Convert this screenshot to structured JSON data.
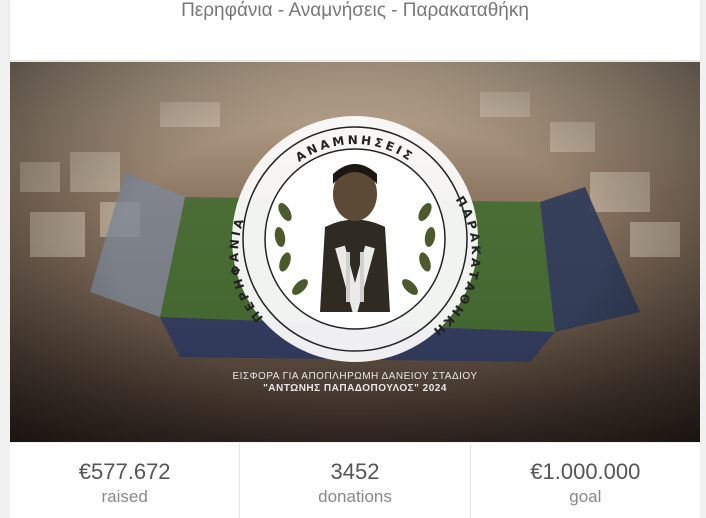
{
  "header": {
    "title": "Περηφάνια - Αναμνήσεις - Παρακαταθήκη"
  },
  "hero": {
    "seal_top": "ΑΝΑΜΝΗΣΕΙΣ",
    "seal_left": "ΠΕΡΗΦΑΝΙΑ",
    "seal_right": "ΠΑΡΑΚΑΤΑΘΗΚΗ",
    "caption_line1": "ΕΙΣΦΟΡΑ ΓΙΑ ΑΠΟΠΛΗΡΩΜΗ ΔΑΝΕΙΟΥ ΣΤΑΔΙΟΥ",
    "caption_line2": "\"ΑΝΤΩΝΗΣ ΠΑΠΑΔΟΠΟΥΛΟΣ\" 2024"
  },
  "stats": {
    "raised_value": "€577.672",
    "raised_label": "raised",
    "donations_value": "3452",
    "donations_label": "donations",
    "goal_value": "€1.000.000",
    "goal_label": "goal"
  }
}
